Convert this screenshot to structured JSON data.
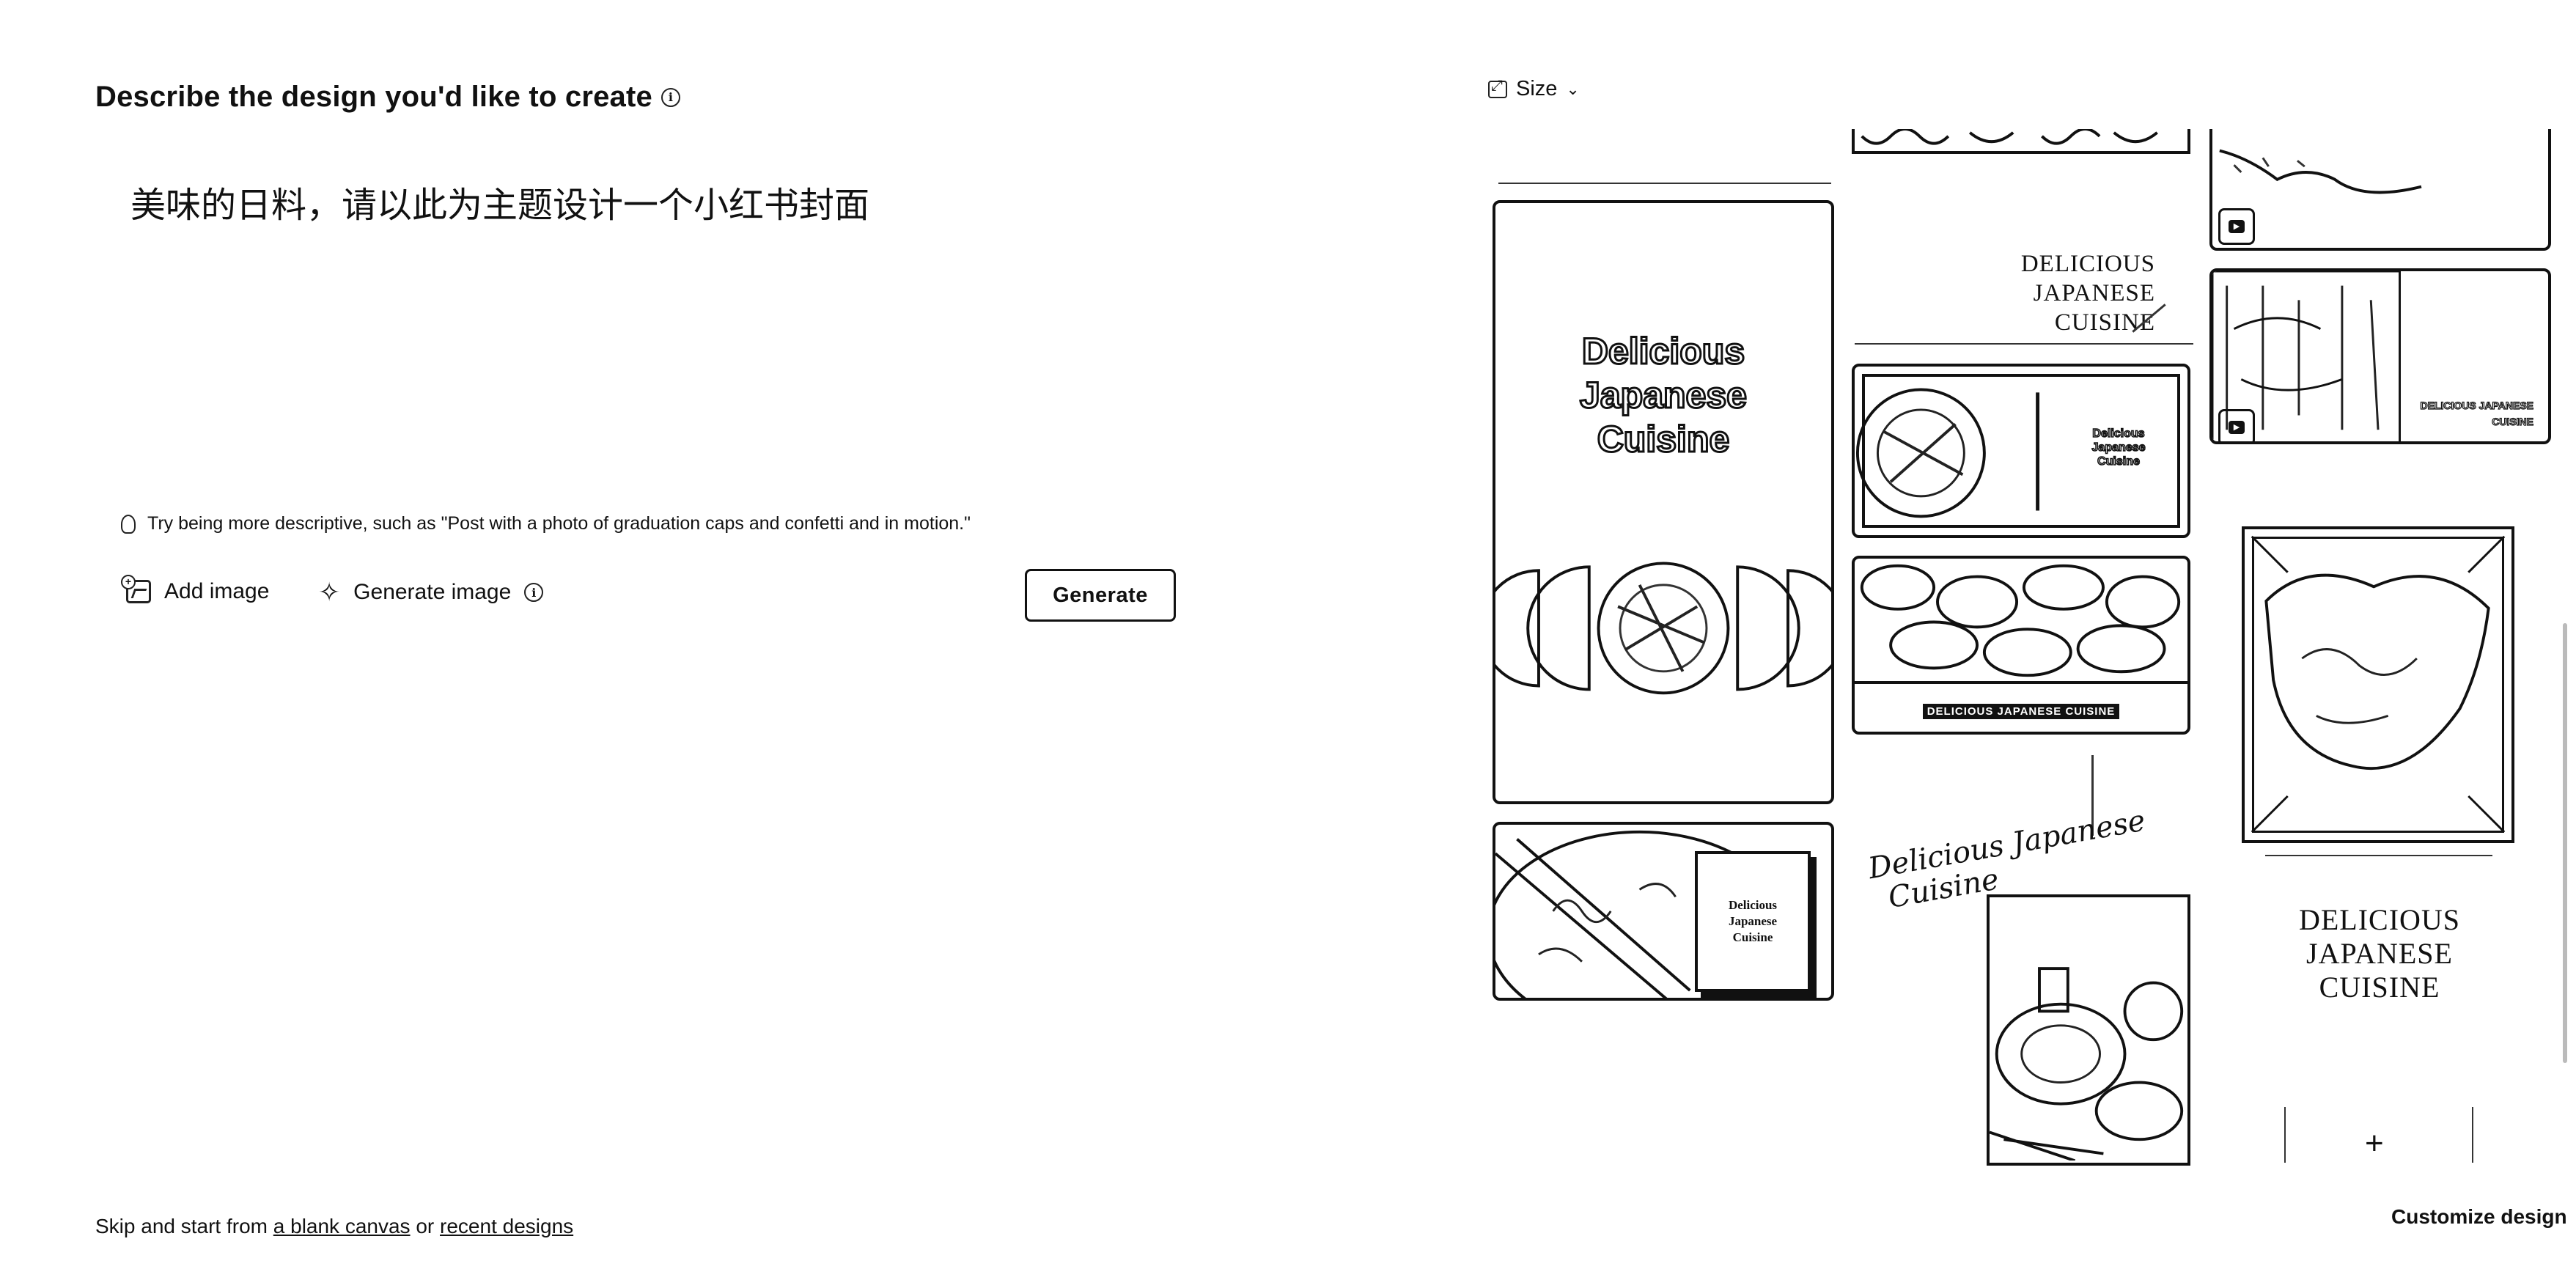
{
  "composer": {
    "heading": "Describe the design you'd like to create",
    "prompt_text": "美味的日料，请以此为主题设计一个小红书封面",
    "tip": "Try being more descriptive, such as \"Post with a photo of graduation caps and confetti and in motion.\"",
    "add_image_label": "Add image",
    "generate_image_label": "Generate image",
    "generate_button_label": "Generate",
    "skip_prefix": "Skip and start from ",
    "blank_canvas_link": "a blank canvas",
    "skip_or": " or ",
    "recent_designs_link": "recent designs"
  },
  "gallery": {
    "size_label": "Size",
    "customize_label": "Customize design",
    "templates": [
      {
        "title": "Delicious Japanese Cuisine"
      },
      {
        "title": "DELICIOUS JAPANESE CUISINE"
      },
      {
        "title": "Delicious Japanese Cuisine"
      },
      {
        "title": "DELICIOUS JAPANESE CUISINE"
      },
      {
        "title": "DELICIOUS JAPANESE CUISINE"
      },
      {
        "title": "Delicious Japanese Cuisine"
      },
      {
        "title": "Delicious Japanese Cuisine"
      },
      {
        "title": "DELICIOUS JAPANESE CUISINE"
      }
    ],
    "card_tall_lines": [
      "Delicious",
      "Japanese",
      "Cuisine"
    ],
    "card_small_lines": [
      "Delicious",
      "Japanese",
      "Cuisine"
    ],
    "card_gold_lines": [
      "DELICIOUS",
      "JAPANESE",
      "CUISINE"
    ],
    "card_serif_lines": [
      "DELICIOUS JAPANESE",
      "CUISINE"
    ],
    "script_line1": "Delicious Japanese",
    "script_line2": "Cuisine"
  }
}
